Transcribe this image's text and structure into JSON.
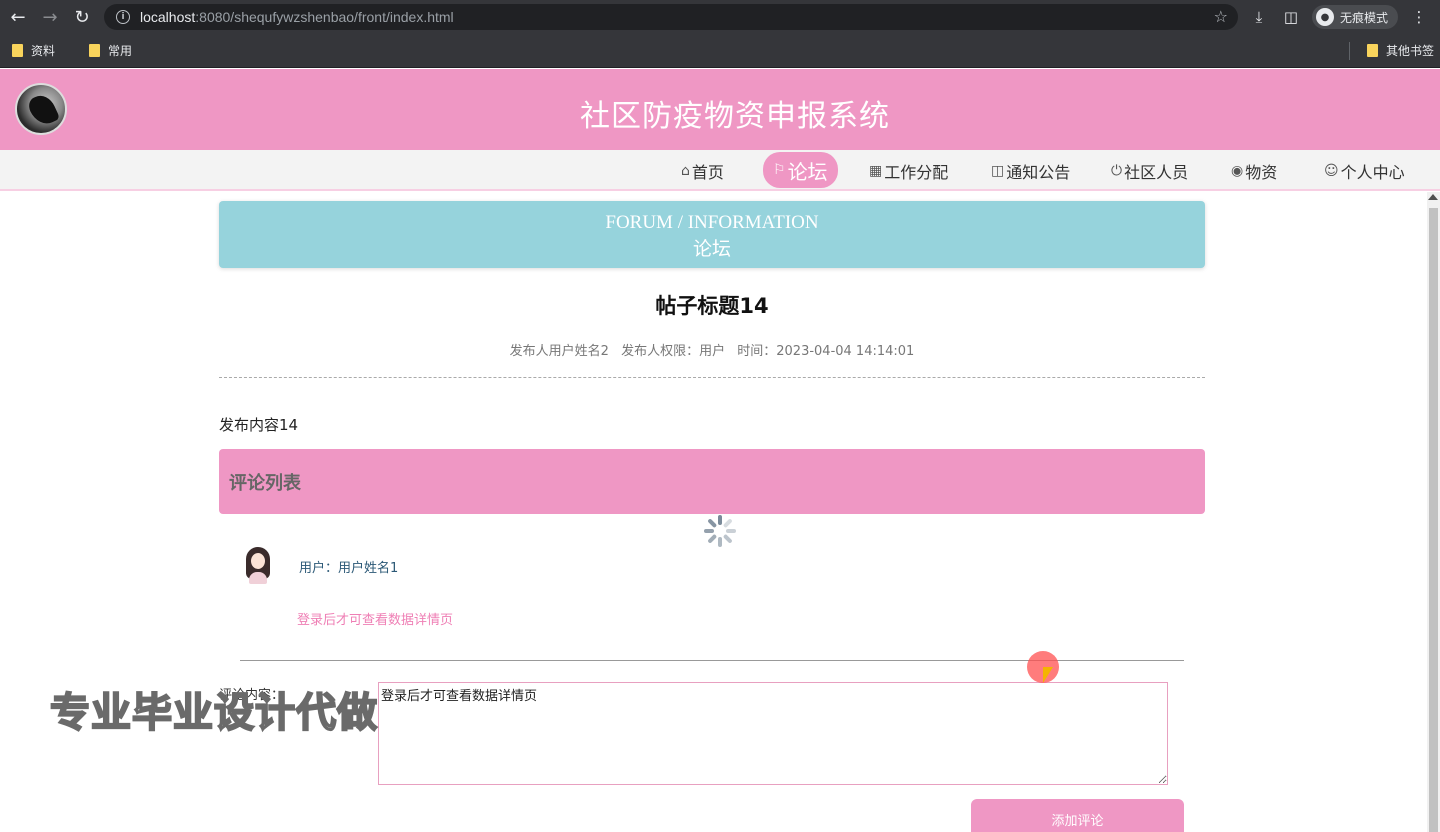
{
  "browser": {
    "url_host": "localhost",
    "url_rest": ":8080/shequfywzshenbao/front/index.html",
    "incognito_label": "无痕模式",
    "bookmarks": [
      "资料",
      "常用"
    ],
    "other_bookmarks": "其他书签"
  },
  "site": {
    "title": "社区防疫物资申报系统"
  },
  "menu": [
    {
      "label": "首页",
      "icon": "home-icon"
    },
    {
      "label": "论坛",
      "icon": "flag-icon",
      "active": true
    },
    {
      "label": "工作分配",
      "icon": "grid-icon"
    },
    {
      "label": "通知公告",
      "icon": "book-icon"
    },
    {
      "label": "社区人员",
      "icon": "power-icon"
    },
    {
      "label": "物资",
      "icon": "palette-icon"
    },
    {
      "label": "个人中心",
      "icon": "user-icon"
    }
  ],
  "banner": {
    "en": "FORUM / INFORMATION",
    "cn": "论坛"
  },
  "post": {
    "title": "帖子标题14",
    "author": "发布人用户姓名2",
    "role": "发布人权限：用户",
    "time": "时间：2023-04-04 14:14:01",
    "content": "发布内容14"
  },
  "comments": {
    "header": "评论列表",
    "items": [
      {
        "user": "用户：用户姓名1",
        "text": "登录后才可查看数据详情页"
      }
    ]
  },
  "form": {
    "label": "评论内容：",
    "textarea_value": "登录后才可查看数据详情页",
    "submit_label": "添加评论"
  },
  "watermark": "专业毕业设计代做",
  "colors": {
    "brand_pink": "#ef97c4",
    "banner_teal": "#96d3dc"
  }
}
